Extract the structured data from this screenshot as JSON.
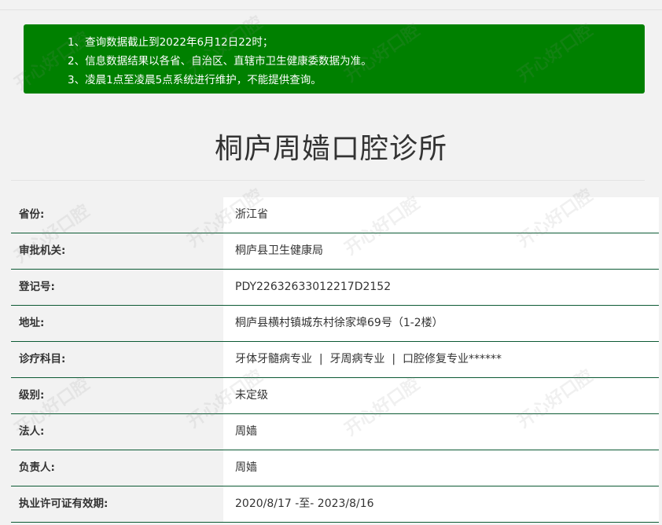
{
  "notice": {
    "lines": [
      "1、查询数据截止到2022年6月12日22时；",
      "2、信息数据结果以各省、自治区、直辖市卫生健康委数据为准。",
      "3、凌晨1点至凌晨5点系统进行维护，不能提供查询。"
    ],
    "color": "#008000"
  },
  "title": "桐庐周嫱口腔诊所",
  "fields": [
    {
      "label": "省份:",
      "value": "浙江省"
    },
    {
      "label": "审批机关:",
      "value": "桐庐县卫生健康局"
    },
    {
      "label": "登记号:",
      "value": "PDY22632633012217D2152"
    },
    {
      "label": "地址:",
      "value": "桐庐县横村镇城东村徐家埠69号（1-2楼）"
    },
    {
      "label": "诊疗科目:",
      "value": "牙体牙髓病专业  |  牙周病专业  |  口腔修复专业******"
    },
    {
      "label": "级别:",
      "value": "未定级"
    },
    {
      "label": "法人:",
      "value": "周嫱"
    },
    {
      "label": "负责人:",
      "value": "周嫱"
    },
    {
      "label": "执业许可证有效期:",
      "value": "2020/8/17 -至- 2023/8/16"
    }
  ],
  "watermark_text": "开心好口腔"
}
